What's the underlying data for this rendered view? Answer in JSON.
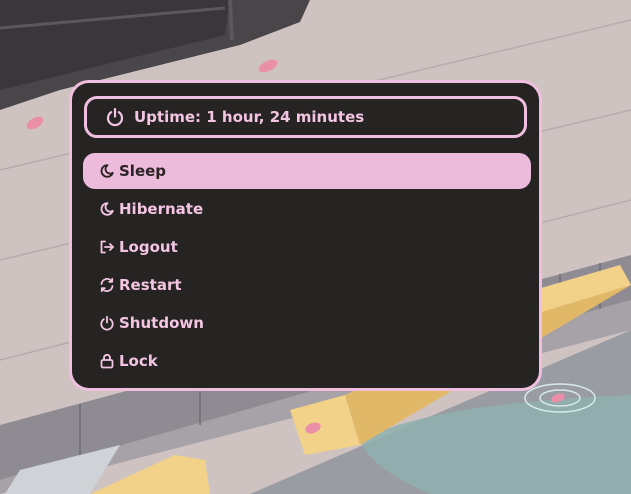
{
  "colors": {
    "accent": "#f0bfdf",
    "menu_background": "#262323",
    "selected_text": "#2b2224"
  },
  "header": {
    "icon": "power-icon",
    "uptime_text": "Uptime: 1 hour, 24 minutes"
  },
  "items": [
    {
      "label": "Sleep",
      "icon": "moon-icon",
      "selected": true
    },
    {
      "label": "Hibernate",
      "icon": "moon-icon",
      "selected": false
    },
    {
      "label": "Logout",
      "icon": "logout-icon",
      "selected": false
    },
    {
      "label": "Restart",
      "icon": "refresh-icon",
      "selected": false
    },
    {
      "label": "Shutdown",
      "icon": "power-icon",
      "selected": false
    },
    {
      "label": "Lock",
      "icon": "lock-icon",
      "selected": false
    }
  ]
}
